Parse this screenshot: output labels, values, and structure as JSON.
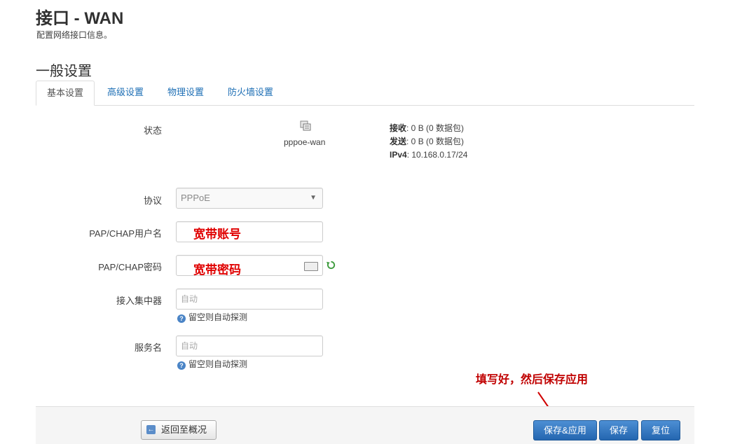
{
  "header": {
    "title": "接口 - WAN",
    "description": "配置网络接口信息。"
  },
  "section": {
    "title": "一般设置"
  },
  "tabs": [
    {
      "label": "基本设置",
      "active": true
    },
    {
      "label": "高级设置"
    },
    {
      "label": "物理设置"
    },
    {
      "label": "防火墙设置"
    }
  ],
  "status": {
    "label": "状态",
    "interface_name": "pppoe-wan",
    "rx_label": "接收",
    "rx_value": ": 0 B (0 数据包)",
    "tx_label": "发送",
    "tx_value": ": 0 B (0 数据包)",
    "ipv4_label": "IPv4",
    "ipv4_value": ": 10.168.0.17/24"
  },
  "form": {
    "protocol": {
      "label": "协议",
      "value": "PPPoE"
    },
    "username": {
      "label": "PAP/CHAP用户名",
      "overlay": "宽带账号"
    },
    "password": {
      "label": "PAP/CHAP密码",
      "overlay": "宽带密码"
    },
    "concentrator": {
      "label": "接入集中器",
      "placeholder": "自动",
      "hint": "留空则自动探测"
    },
    "service": {
      "label": "服务名",
      "placeholder": "自动",
      "hint": "留空则自动探测"
    }
  },
  "annotation": "填写好，然后保存应用",
  "footer": {
    "back_label": "返回至概况",
    "save_apply_label": "保存&应用",
    "save_label": "保存",
    "reset_label": "复位"
  },
  "colors": {
    "primary_button": "#2466b0",
    "tab_link": "#1e6fb5",
    "annotation": "#c00000"
  }
}
